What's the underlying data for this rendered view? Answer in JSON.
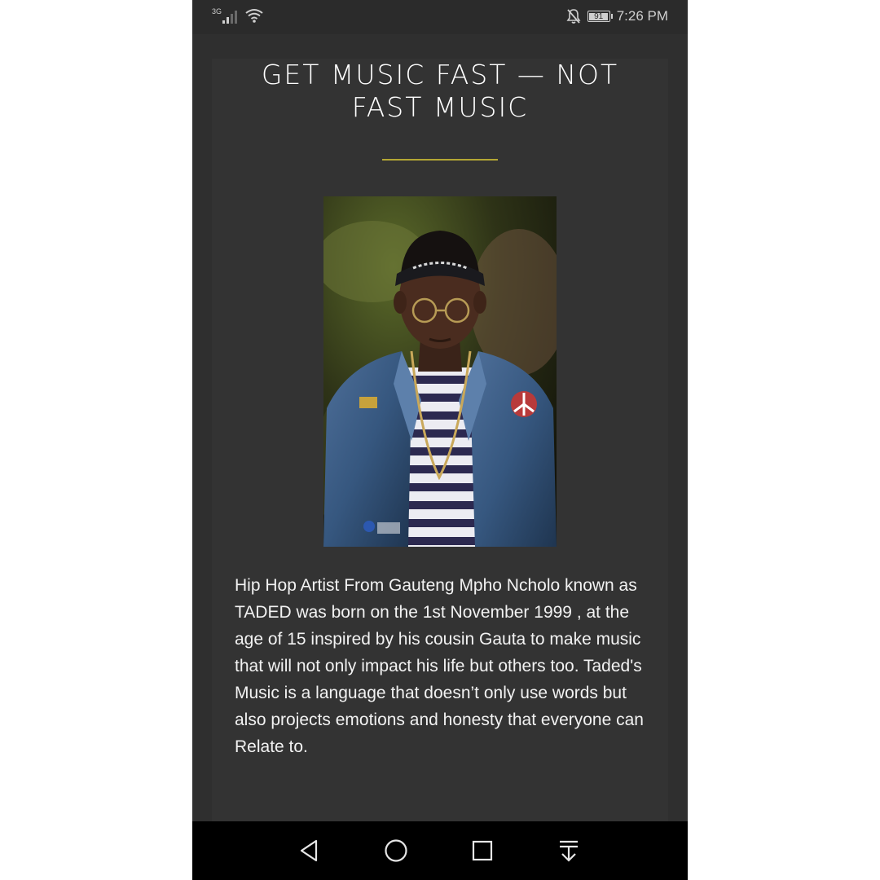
{
  "status_bar": {
    "network_type": "3G",
    "battery_level": "91",
    "time": "7:26 PM",
    "icons": [
      "signal-icon",
      "wifi-icon",
      "silent-bell-icon",
      "battery-icon"
    ]
  },
  "page": {
    "heading_line1": "GET MUSIC FAST — NOT",
    "heading_line2": "FAST MUSIC",
    "accent_color": "#b4a734",
    "background_color": "#333333",
    "photo_icon": "artist-portrait-photo",
    "bio": "Hip Hop Artist From Gauteng Mpho Ncholo known as TADED was born on the 1st November 1999 , at the age of 15 inspired by his cousin Gauta to make music that will not only impact his life but others too. Taded's Music is a language that doesn’t only use words but also projects emotions and honesty that everyone can Relate to."
  },
  "nav_bar": {
    "buttons": [
      "back-icon",
      "home-icon",
      "recents-icon",
      "notifications-pull-icon"
    ]
  }
}
